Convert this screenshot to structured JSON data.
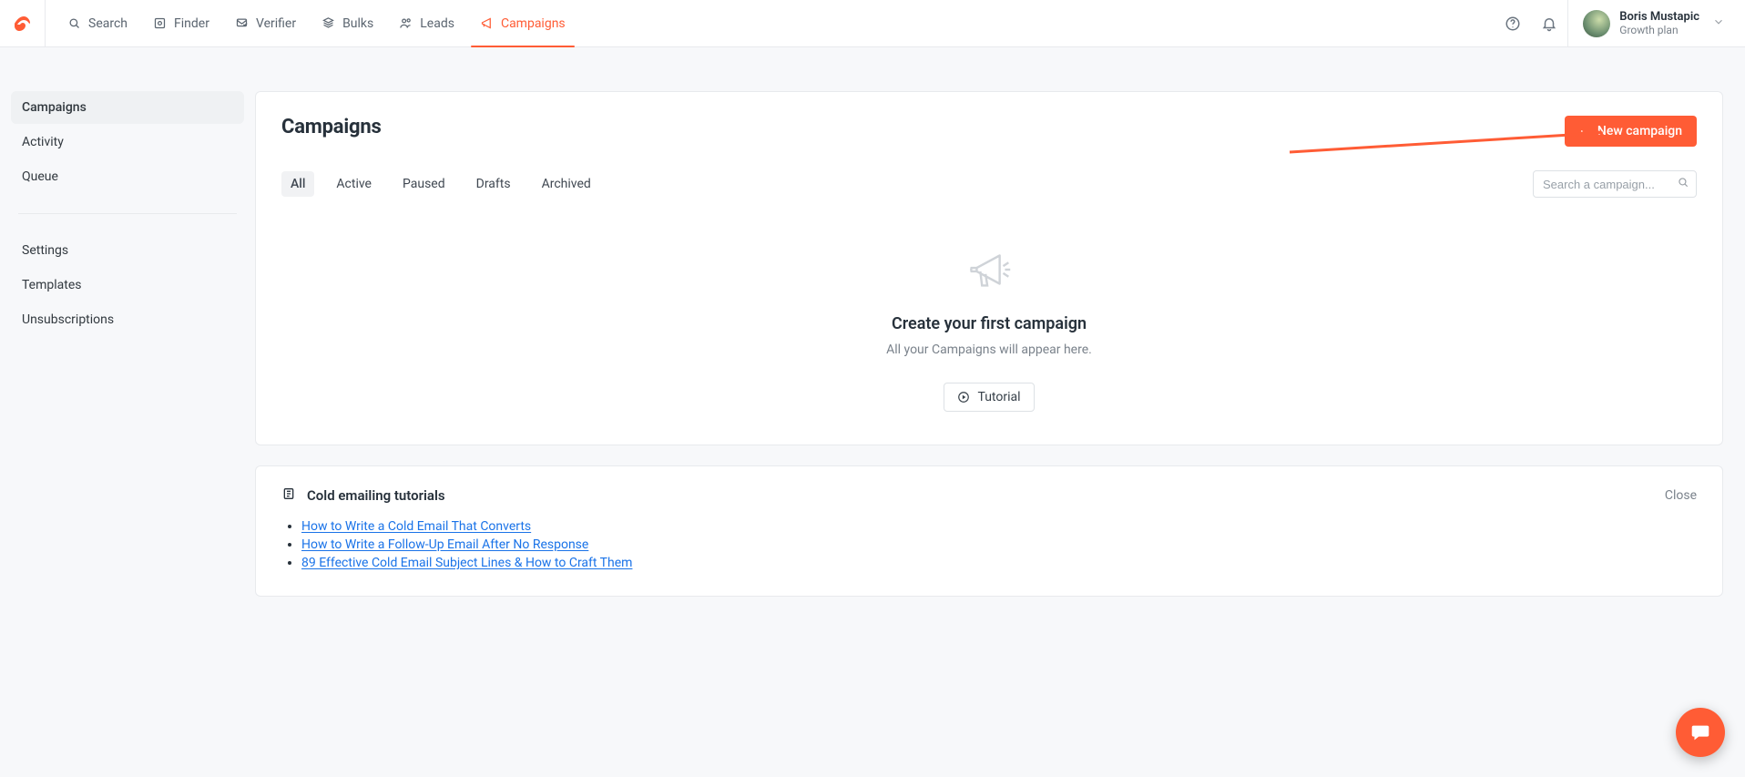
{
  "colors": {
    "accent": "#ff5c35",
    "link": "#1a73e8"
  },
  "topnav": {
    "items": [
      {
        "label": "Search",
        "icon": "search-icon"
      },
      {
        "label": "Finder",
        "icon": "finder-icon"
      },
      {
        "label": "Verifier",
        "icon": "verifier-icon"
      },
      {
        "label": "Bulks",
        "icon": "bulks-icon"
      },
      {
        "label": "Leads",
        "icon": "leads-icon"
      },
      {
        "label": "Campaigns",
        "icon": "campaigns-icon",
        "active": true
      }
    ]
  },
  "user": {
    "name": "Boris Mustapic",
    "plan": "Growth plan"
  },
  "sidebar": {
    "primary": [
      {
        "label": "Campaigns",
        "active": true
      },
      {
        "label": "Activity"
      },
      {
        "label": "Queue"
      }
    ],
    "secondary": [
      {
        "label": "Settings"
      },
      {
        "label": "Templates"
      },
      {
        "label": "Unsubscriptions"
      }
    ]
  },
  "main": {
    "title": "Campaigns",
    "new_button": "New campaign",
    "tabs": [
      {
        "label": "All",
        "active": true
      },
      {
        "label": "Active"
      },
      {
        "label": "Paused"
      },
      {
        "label": "Drafts"
      },
      {
        "label": "Archived"
      }
    ],
    "search_placeholder": "Search a campaign...",
    "empty": {
      "title": "Create your first campaign",
      "subtitle": "All your Campaigns will appear here.",
      "tutorial_button": "Tutorial"
    }
  },
  "tutorials": {
    "title": "Cold emailing tutorials",
    "close": "Close",
    "links": [
      "How to Write a Cold Email That Converts",
      "How to Write a Follow-Up Email After No Response",
      "89 Effective Cold Email Subject Lines & How to Craft Them"
    ]
  }
}
